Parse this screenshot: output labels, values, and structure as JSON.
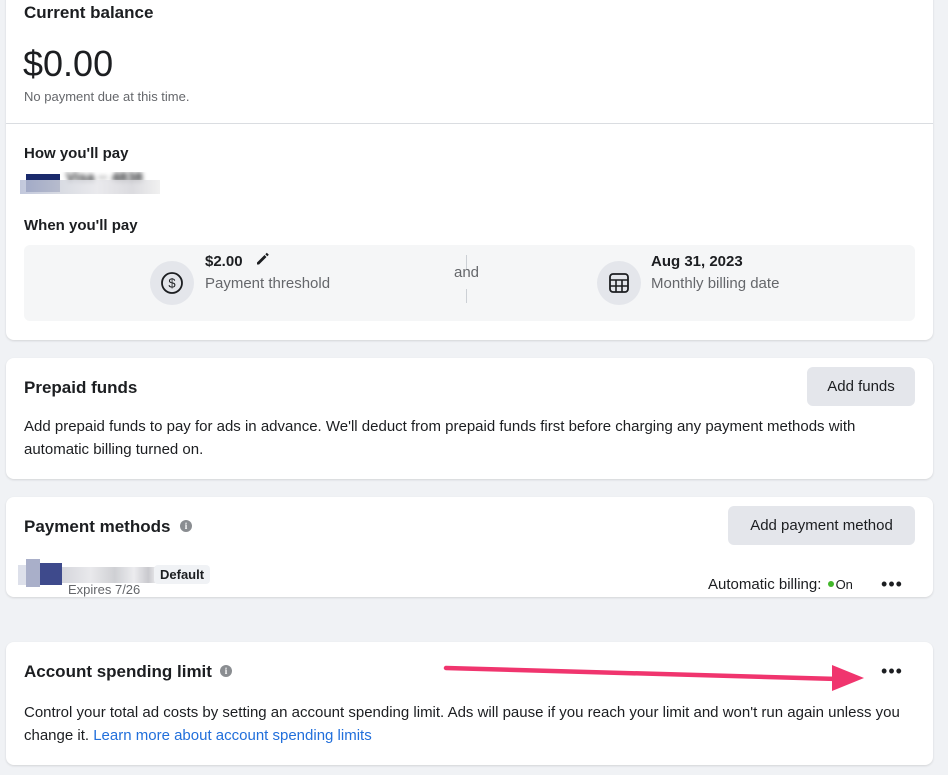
{
  "balance": {
    "title": "Current balance",
    "amount": "$0.00",
    "note": "No payment due at this time.",
    "how_title": "How you'll pay",
    "card_text": "Visa ·· 4838",
    "when_title": "When you'll pay",
    "threshold_value": "$2.00",
    "threshold_label": "Payment threshold",
    "and_text": "and",
    "billing_date": "Aug 31, 2023",
    "billing_date_label": "Monthly billing date"
  },
  "prepaid": {
    "title": "Prepaid funds",
    "add_button": "Add funds",
    "description": "Add prepaid funds to pay for ads in advance. We'll deduct from prepaid funds first before charging any payment methods with automatic billing turned on."
  },
  "payment_methods": {
    "title": "Payment methods",
    "add_button": "Add payment method",
    "default_badge": "Default",
    "expires": "Expires 7/26",
    "auto_billing_label": "Automatic billing:",
    "auto_billing_status": "On",
    "status_color": "#42b72a"
  },
  "spending_limit": {
    "title": "Account spending limit",
    "description": "Control your total ad costs by setting an account spending limit. Ads will pause if you reach your limit and won't run again unless you change it.",
    "link": "Learn more about account spending limits"
  },
  "colors": {
    "accent_link": "#216fdb",
    "arrow": "#f0356e",
    "card_brand": "#1a2a6c"
  }
}
